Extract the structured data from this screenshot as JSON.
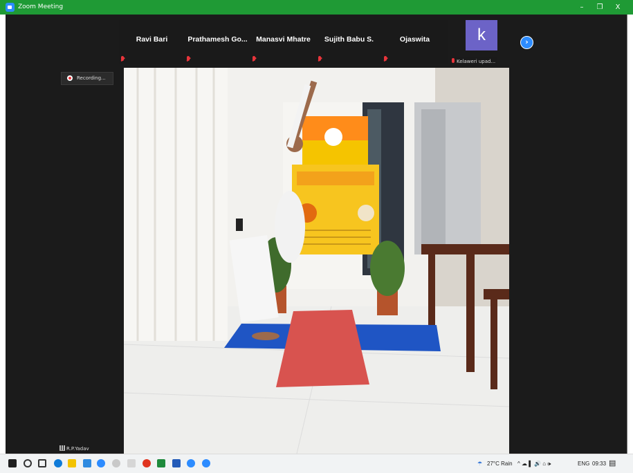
{
  "window": {
    "title": "Zoom Meeting",
    "minimize": "–",
    "maximize": "❐",
    "close": "X"
  },
  "gallery": {
    "participants": [
      {
        "name": "Ravi Bari"
      },
      {
        "name": "Prathamesh  Go..."
      },
      {
        "name": "Manasvi Mhatre"
      },
      {
        "name": "Sujith Babu S."
      },
      {
        "name": "Ojaswita"
      }
    ],
    "avatar_participant": {
      "initial": "k",
      "name": "Kelaweri upad..."
    },
    "next_page_icon": "chevron-right-icon"
  },
  "recording": {
    "label": "Recording..."
  },
  "self_view": {
    "name": "R.P.Yadav"
  },
  "taskbar": {
    "weather": "27°C  Rain",
    "language": "ENG",
    "time": "09:33",
    "tray_icons": "^ ☁ ▌ 🔊 ⌂ 🕪"
  },
  "colors": {
    "title_bar": "#1f9a35",
    "zoom_blue": "#2d8cff",
    "mute_red": "#e8353b",
    "avatar_purple": "#6c63c7"
  }
}
